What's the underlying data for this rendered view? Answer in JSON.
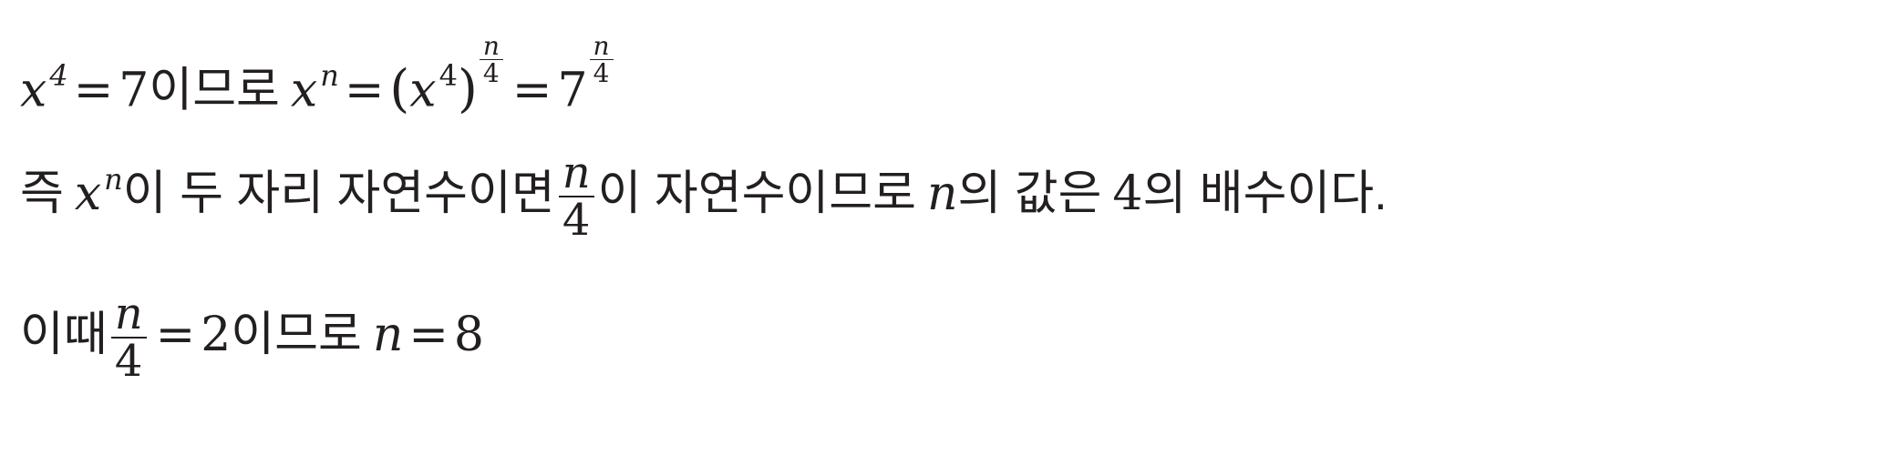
{
  "lines": {
    "line1": {
      "base_x": "x",
      "exp_4": "4",
      "eq": "=",
      "seven": "7",
      "text_imeuro": "이므로",
      "exp_n": "n",
      "lparen": "(",
      "rparen": ")",
      "frac_num": "n",
      "frac_den": "4"
    },
    "line2": {
      "text_jeuk": "즉",
      "base_x": "x",
      "exp_n": "n",
      "text_a": "이 두 자리 자연수이면",
      "frac_num": "n",
      "frac_den": "4",
      "text_b": "이 자연수이므로",
      "var_n": "n",
      "text_c": "의 값은",
      "four": "4",
      "text_d": "의 배수이다."
    },
    "line3": {
      "text_ittae": "이때",
      "frac_num": "n",
      "frac_den": "4",
      "eq": "=",
      "two": "2",
      "text_imeuro": "이므로",
      "var_n": "n",
      "eight": "8"
    }
  }
}
